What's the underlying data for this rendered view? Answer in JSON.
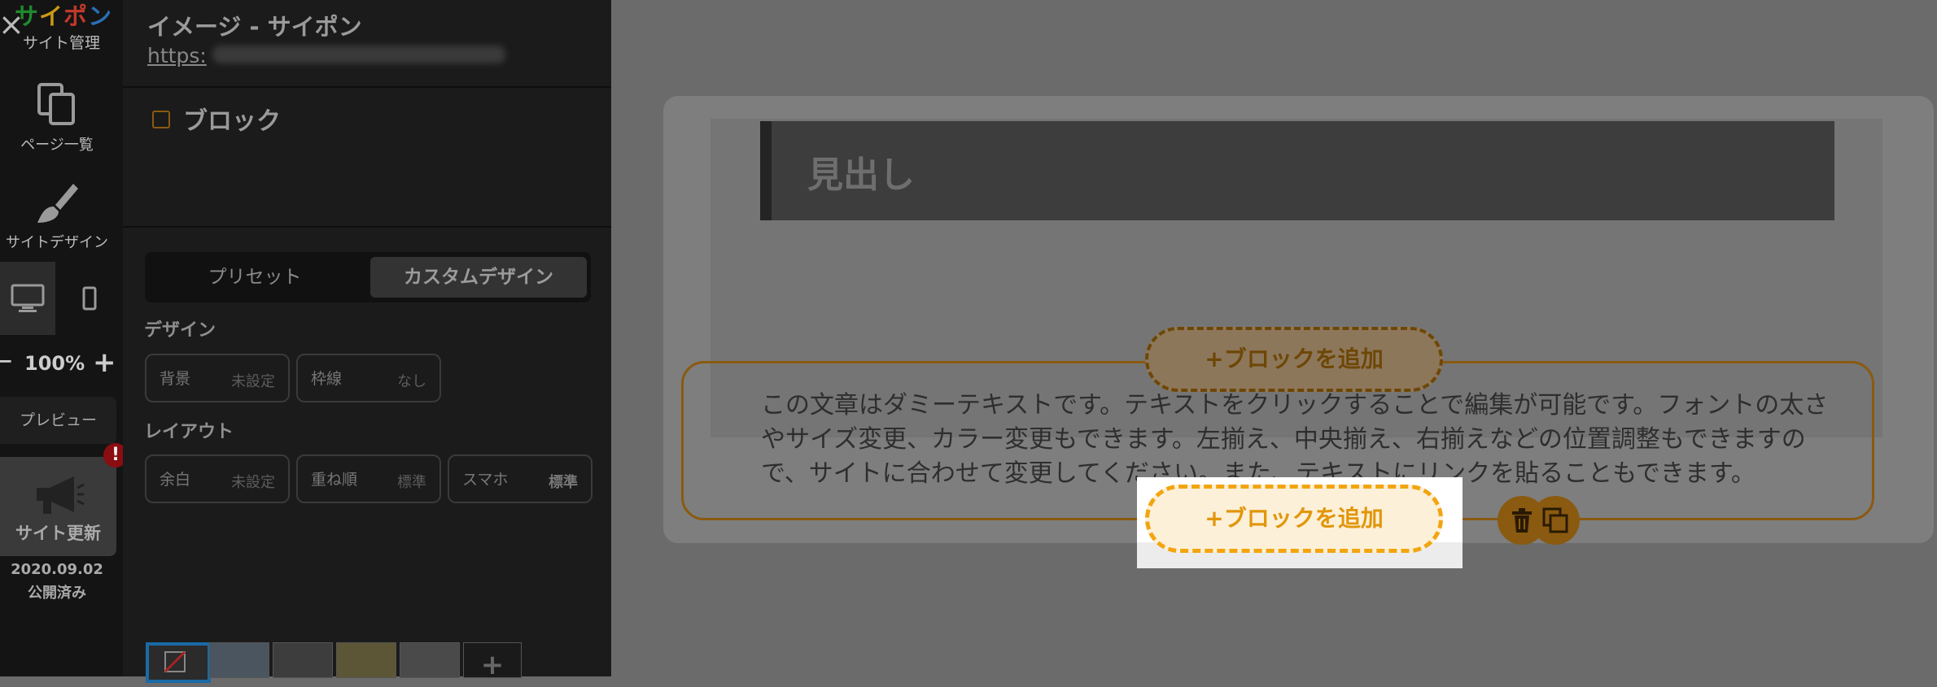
{
  "rail": {
    "logo": "サイポン",
    "logo_colors": [
      "#1f8a2e",
      "#c99a14",
      "#c0392b",
      "#2a6fb3"
    ],
    "site_admin": "サイト管理",
    "pages_label": "ページ一覧",
    "design_label": "サイトデザイン",
    "zoom_value": "100%",
    "preview_label": "プレビュー",
    "update_label": "サイト更新",
    "update_badge": "!",
    "publish_date": "2020.09.02",
    "publish_status": "公開済み"
  },
  "panel": {
    "title": "イメージ - サイポン",
    "url_prefix": "https:",
    "section_title": "ブロック",
    "tabs": [
      {
        "label": "プリセット",
        "active": false
      },
      {
        "label": "カスタムデザイン",
        "active": true
      }
    ],
    "design_label": "デザイン",
    "design_options": [
      {
        "key": "背景",
        "value": "未設定"
      },
      {
        "key": "枠線",
        "value": "なし"
      }
    ],
    "layout_label": "レイアウト",
    "layout_options": [
      {
        "key": "余白",
        "value": "未設定"
      },
      {
        "key": "重ね順",
        "value": "標準"
      },
      {
        "key": "スマホ",
        "value": "標準"
      }
    ]
  },
  "canvas": {
    "heading": "見出し",
    "body_text": "この文章はダミーテキストです。テキストをクリックすることで編集が可能です。フォントの太さやサイズ変更、カラー変更もできます。左揃え、中央揃え、右揃えなどの位置調整もできますので、サイトに合わせて変更してください。また、テキストにリンクを貼ることもできます。",
    "add_block_label": "+ブロックを追加",
    "add_block_label_focus": "+ブロックを追加"
  },
  "colors": {
    "accent": "#f2a511",
    "accent_dark": "#8a5a10",
    "badge": "#8a0d12"
  }
}
